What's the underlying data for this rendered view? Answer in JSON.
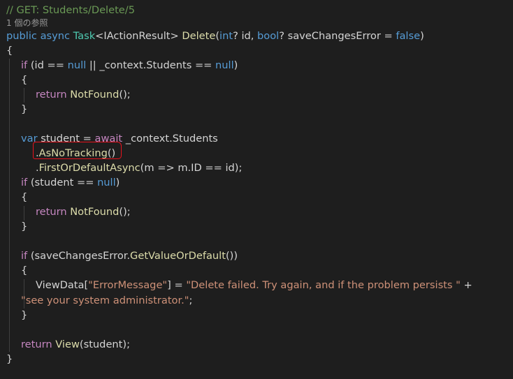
{
  "codelens": {
    "text": "1 個の参照"
  },
  "lines": [
    {
      "text": "// GET: Students/Delete/5"
    },
    {
      "text": "public async Task<IActionResult> Delete(int? id, bool? saveChangesError = false)"
    },
    {
      "text": "{"
    },
    {
      "text": "if (id == null || _context.Students == null)"
    },
    {
      "text": "{"
    },
    {
      "text": "return NotFound();"
    },
    {
      "text": "}"
    },
    {
      "text": ""
    },
    {
      "text": "var student = await _context.Students"
    },
    {
      "text": ".AsNoTracking()"
    },
    {
      "text": ".FirstOrDefaultAsync(m => m.ID == id);"
    },
    {
      "text": "if (student == null)"
    },
    {
      "text": "{"
    },
    {
      "text": "return NotFound();"
    },
    {
      "text": "}"
    },
    {
      "text": ""
    },
    {
      "text": "if (saveChangesError.GetValueOrDefault())"
    },
    {
      "text": "{"
    },
    {
      "text": "ViewData[\"ErrorMessage\"] = \"Delete failed. Try again, and if the problem persists \" +"
    },
    {
      "text": "\"see your system administrator.\";"
    },
    {
      "text": "}"
    },
    {
      "text": ""
    },
    {
      "text": "return View(student);"
    },
    {
      "text": "}"
    }
  ],
  "tokens": [
    [
      {
        "t": "// GET: Students/Delete/5",
        "c": "cmt"
      }
    ],
    [
      {
        "t": "public",
        "c": "kw"
      },
      {
        "t": " ",
        "c": "pl"
      },
      {
        "t": "async",
        "c": "kw"
      },
      {
        "t": " ",
        "c": "pl"
      },
      {
        "t": "Task",
        "c": "type"
      },
      {
        "t": "<IActionResult> ",
        "c": "pl"
      },
      {
        "t": "Delete",
        "c": "fn"
      },
      {
        "t": "(",
        "c": "pl"
      },
      {
        "t": "int",
        "c": "kw"
      },
      {
        "t": "? id, ",
        "c": "pl"
      },
      {
        "t": "bool",
        "c": "kw"
      },
      {
        "t": "? saveChangesError = ",
        "c": "pl"
      },
      {
        "t": "false",
        "c": "kw"
      },
      {
        "t": ")",
        "c": "pl"
      }
    ],
    [
      {
        "t": "{",
        "c": "pl"
      }
    ],
    [
      {
        "t": "if",
        "c": "ctl"
      },
      {
        "t": " (id == ",
        "c": "pl"
      },
      {
        "t": "null",
        "c": "kw"
      },
      {
        "t": " || _context.Students == ",
        "c": "pl"
      },
      {
        "t": "null",
        "c": "kw"
      },
      {
        "t": ")",
        "c": "pl"
      }
    ],
    [
      {
        "t": "{",
        "c": "pl"
      }
    ],
    [
      {
        "t": "return",
        "c": "ctl"
      },
      {
        "t": " ",
        "c": "pl"
      },
      {
        "t": "NotFound",
        "c": "fn"
      },
      {
        "t": "();",
        "c": "pl"
      }
    ],
    [
      {
        "t": "}",
        "c": "pl"
      }
    ],
    [],
    [
      {
        "t": "var",
        "c": "kw"
      },
      {
        "t": " student = ",
        "c": "pl"
      },
      {
        "t": "await",
        "c": "ctl"
      },
      {
        "t": " _context.Students",
        "c": "pl"
      }
    ],
    [
      {
        "t": ".",
        "c": "pl"
      },
      {
        "t": "AsNoTracking",
        "c": "fn"
      },
      {
        "t": "()",
        "c": "pl"
      }
    ],
    [
      {
        "t": ".",
        "c": "pl"
      },
      {
        "t": "FirstOrDefaultAsync",
        "c": "fn"
      },
      {
        "t": "(m => m.ID == id);",
        "c": "pl"
      }
    ],
    [
      {
        "t": "if",
        "c": "ctl"
      },
      {
        "t": " (student == ",
        "c": "pl"
      },
      {
        "t": "null",
        "c": "kw"
      },
      {
        "t": ")",
        "c": "pl"
      }
    ],
    [
      {
        "t": "{",
        "c": "pl"
      }
    ],
    [
      {
        "t": "return",
        "c": "ctl"
      },
      {
        "t": " ",
        "c": "pl"
      },
      {
        "t": "NotFound",
        "c": "fn"
      },
      {
        "t": "();",
        "c": "pl"
      }
    ],
    [
      {
        "t": "}",
        "c": "pl"
      }
    ],
    [],
    [
      {
        "t": "if",
        "c": "ctl"
      },
      {
        "t": " (saveChangesError.",
        "c": "pl"
      },
      {
        "t": "GetValueOrDefault",
        "c": "fn"
      },
      {
        "t": "())",
        "c": "pl"
      }
    ],
    [
      {
        "t": "{",
        "c": "pl"
      }
    ],
    [
      {
        "t": "ViewData[",
        "c": "pl"
      },
      {
        "t": "\"ErrorMessage\"",
        "c": "str"
      },
      {
        "t": "] = ",
        "c": "pl"
      },
      {
        "t": "\"Delete failed. Try again, and if the problem persists \"",
        "c": "str"
      },
      {
        "t": " +",
        "c": "pl"
      }
    ],
    [
      {
        "t": "\"see your system administrator.\"",
        "c": "str"
      },
      {
        "t": ";",
        "c": "pl"
      }
    ],
    [
      {
        "t": "}",
        "c": "pl"
      }
    ],
    [],
    [
      {
        "t": "return",
        "c": "ctl"
      },
      {
        "t": " ",
        "c": "pl"
      },
      {
        "t": "View",
        "c": "fn"
      },
      {
        "t": "(student);",
        "c": "pl"
      }
    ],
    [
      {
        "t": "}",
        "c": "pl"
      }
    ]
  ],
  "colors": {
    "background": "#1e1e1e",
    "keyword": "#569cd6",
    "control": "#c586c0",
    "type": "#4ec9b0",
    "function": "#dcdcaa",
    "string": "#ce9178",
    "comment": "#6a9955",
    "plain": "#d4d4d4",
    "annotation": "#e8121c"
  }
}
